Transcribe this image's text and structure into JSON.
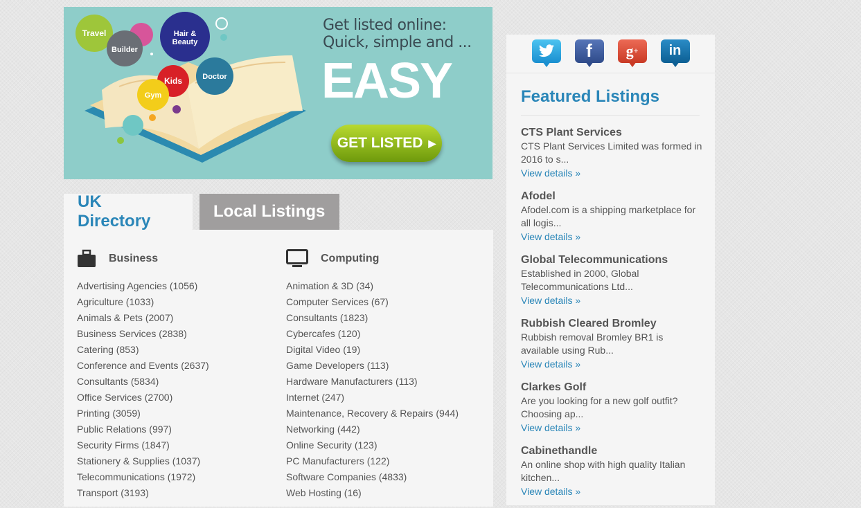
{
  "banner": {
    "headline_line1": "Get listed online:",
    "headline_line2": "Quick, simple and ...",
    "easy": "EASY",
    "button_label": "GET LISTED",
    "bubbles": [
      "Travel",
      "Builder",
      "Hair &",
      "Beauty",
      "Kids",
      "Doctor",
      "Gym"
    ]
  },
  "tabs": {
    "uk": "UK Directory",
    "local": "Local Listings"
  },
  "business": {
    "title": "Business",
    "icon": "briefcase-icon",
    "items": [
      "Advertising Agencies (1056)",
      "Agriculture (1033)",
      "Animals & Pets (2007)",
      "Business Services (2838)",
      "Catering (853)",
      "Conference and Events (2637)",
      "Consultants (5834)",
      "Office Services (2700)",
      "Printing (3059)",
      "Public Relations (997)",
      "Security Firms (1847)",
      "Stationery & Supplies (1037)",
      "Telecommunications (1972)",
      "Transport (3193)"
    ]
  },
  "computing": {
    "title": "Computing",
    "icon": "monitor-icon",
    "items": [
      "Animation & 3D (34)",
      "Computer Services (67)",
      "Consultants (1823)",
      "Cybercafes (120)",
      "Digital Video (19)",
      "Game Developers (113)",
      "Hardware Manufacturers (113)",
      "Internet (247)",
      "Maintenance, Recovery & Repairs (944)",
      "Networking (442)",
      "Online Security (123)",
      "PC Manufacturers (122)",
      "Software Companies (4833)",
      "Web Hosting (16)"
    ]
  },
  "social": [
    {
      "name": "twitter",
      "glyph": "t",
      "color": "#2aa9e0"
    },
    {
      "name": "facebook",
      "glyph": "f",
      "color": "#3b5998"
    },
    {
      "name": "google-plus",
      "glyph": "g+",
      "color": "#dd4b39"
    },
    {
      "name": "linkedin",
      "glyph": "in",
      "color": "#0e76a8"
    }
  ],
  "featured": {
    "title": "Featured Listings",
    "link_label": "View details »",
    "items": [
      {
        "name": "CTS Plant Services",
        "desc": "CTS Plant Services Limited was formed in 2016 to s..."
      },
      {
        "name": "Afodel",
        "desc": "Afodel.com is a shipping marketplace for all logis..."
      },
      {
        "name": "Global Telecommunications",
        "desc": "Established in 2000, Global Telecommunications Ltd..."
      },
      {
        "name": "Rubbish Cleared Bromley",
        "desc": "Rubbish removal Bromley BR1 is available using Rub..."
      },
      {
        "name": "Clarkes Golf",
        "desc": "Are you looking for a new golf outfit? Choosing ap..."
      },
      {
        "name": "Cabinethandle",
        "desc": "An online shop with high quality Italian kitchen..."
      }
    ]
  }
}
